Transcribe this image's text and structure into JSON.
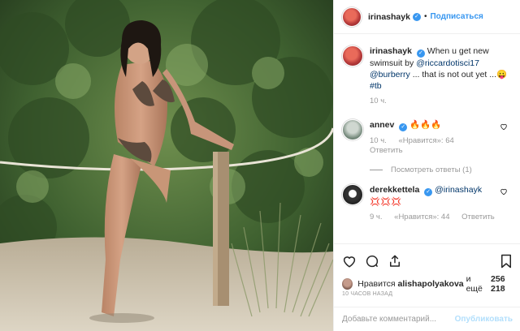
{
  "header": {
    "username": "irinashayk",
    "follow_label": "Подписаться"
  },
  "caption": {
    "username": "irinashayk",
    "text_1": "When u get new swimsuit by",
    "mention_1": "@riccardotisci17",
    "mention_2": "@burberry",
    "text_2": "... that is not out yet ...😛",
    "hashtag": "#tb",
    "time": "10 ч."
  },
  "comments": [
    {
      "username": "annev",
      "text": "🔥🔥🔥",
      "time": "10 ч.",
      "likes": "«Нравится»: 64",
      "reply_label": "Ответить"
    },
    {
      "username": "derekkettela",
      "mention": "@irinashayk",
      "text": "💢💢💢",
      "time": "9 ч.",
      "likes": "«Нравится»: 44",
      "reply_label": "Ответить"
    }
  ],
  "view_replies": "Посмотреть ответы (1)",
  "likes_line": {
    "prefix": "Нравится",
    "user": "alishapolyakova",
    "suffix": "и ещё",
    "count": "256 218"
  },
  "timestamp": "10 ЧАСОВ НАЗАД",
  "add_comment": {
    "placeholder": "Добавьте комментарий...",
    "publish_label": "Опубликовать"
  },
  "icons": {
    "like": "heart-icon",
    "comment": "comment-icon",
    "share": "share-icon",
    "save": "bookmark-icon"
  }
}
